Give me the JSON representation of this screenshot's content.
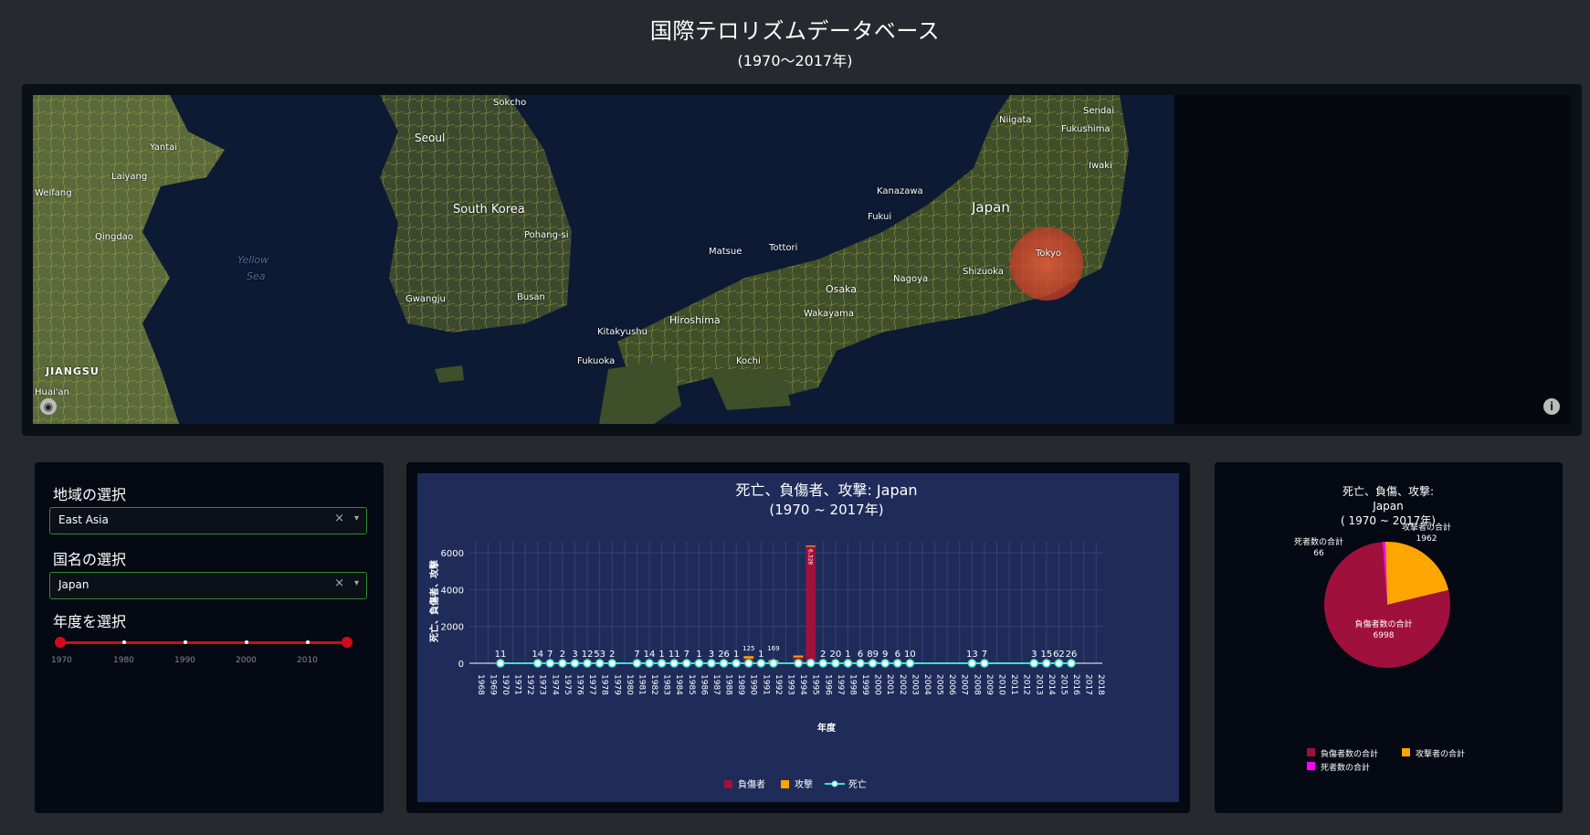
{
  "header": {
    "title": "国際テロリズムデータベース",
    "subtitle": "(1970～2017年)"
  },
  "map": {
    "labels": [
      {
        "name": "Sokcho"
      },
      {
        "name": "Yantai"
      },
      {
        "name": "Seoul"
      },
      {
        "name": "Laiyang"
      },
      {
        "name": "Weifang"
      },
      {
        "name": "Qingdao"
      },
      {
        "name": "South Korea"
      },
      {
        "name": "Yellow"
      },
      {
        "name": "Sea"
      },
      {
        "name": "Pohang-si"
      },
      {
        "name": "Gwangju"
      },
      {
        "name": "Busan"
      },
      {
        "name": "JIANGSU"
      },
      {
        "name": "Huai'an"
      },
      {
        "name": "Niigata"
      },
      {
        "name": "Sendai"
      },
      {
        "name": "Fukushima"
      },
      {
        "name": "Iwaki"
      },
      {
        "name": "Kanazawa"
      },
      {
        "name": "Japan"
      },
      {
        "name": "Fukui"
      },
      {
        "name": "Matsue"
      },
      {
        "name": "Tottori"
      },
      {
        "name": "Tokyo"
      },
      {
        "name": "Shizuoka"
      },
      {
        "name": "Nagoya"
      },
      {
        "name": "Osaka"
      },
      {
        "name": "Hiroshima"
      },
      {
        "name": "Wakayama"
      },
      {
        "name": "Kitakyushu"
      },
      {
        "name": "Fukuoka"
      },
      {
        "name": "Kochi"
      }
    ],
    "info_icon": "info-icon",
    "logo_icon": "mapbox-logo-icon"
  },
  "filters": {
    "region_label": "地域の選択",
    "region_value": "East Asia",
    "country_label": "国名の選択",
    "country_value": "Japan",
    "year_label": "年度を選択",
    "year_marks": [
      "1970",
      "1980",
      "1990",
      "2000",
      "2010"
    ],
    "year_range": [
      1970,
      2017
    ],
    "clear_glyph": "×",
    "arrow_glyph": "▾"
  },
  "chart_data": [
    {
      "type": "bar",
      "title": "死亡、負傷者、攻撃: Japan",
      "subtitle": "(1970 ~ 2017年)",
      "xlabel": "年度",
      "ylabel": "死亡、負傷者、攻撃",
      "ylim": [
        0,
        6600
      ],
      "yticks": [
        0,
        2000,
        4000,
        6000
      ],
      "ytick_labels": [
        "0",
        "2000",
        "4000",
        "6000"
      ],
      "xrange": [
        1967.5,
        2018.5
      ],
      "xticks": [
        1968,
        1969,
        1970,
        1971,
        1972,
        1973,
        1974,
        1975,
        1976,
        1977,
        1978,
        1979,
        1980,
        1981,
        1982,
        1983,
        1984,
        1985,
        1986,
        1987,
        1988,
        1989,
        1990,
        1991,
        1992,
        1993,
        1994,
        1995,
        1996,
        1997,
        1998,
        1999,
        2000,
        2001,
        2002,
        2003,
        2004,
        2005,
        2006,
        2007,
        2008,
        2009,
        2010,
        2011,
        2012,
        2013,
        2014,
        2015,
        2016,
        2017,
        2018
      ],
      "years": [
        1970,
        1973,
        1974,
        1975,
        1976,
        1977,
        1978,
        1979,
        1981,
        1982,
        1983,
        1984,
        1985,
        1986,
        1987,
        1988,
        1989,
        1990,
        1991,
        1992,
        1994,
        1995,
        1996,
        1997,
        1998,
        1999,
        2000,
        2001,
        2002,
        2003,
        2008,
        2009,
        2013,
        2014,
        2015,
        2016
      ],
      "attack_labels": [
        "11",
        "14",
        "7",
        "2",
        "3",
        "12",
        "53",
        "2",
        "7",
        "14",
        "1",
        "11",
        "7",
        "1",
        "3",
        "26",
        "1",
        "125",
        "1",
        "169",
        "",
        "",
        "2",
        "20",
        "1",
        "6",
        "89",
        "9",
        "6",
        "10",
        "13",
        "7",
        "3",
        "15",
        "62",
        "26"
      ],
      "series": [
        {
          "name": "負傷者",
          "color": "#a0103c",
          "values": [
            8,
            0,
            0,
            0,
            0,
            0,
            0,
            0,
            0,
            0,
            0,
            0,
            0,
            0,
            0,
            0,
            0,
            260,
            0,
            0,
            320,
            6328,
            0,
            0,
            0,
            0,
            0,
            0,
            0,
            0,
            0,
            0,
            0,
            0,
            0,
            0
          ]
        },
        {
          "name": "攻撃",
          "color": "#ffa500",
          "values": [
            11,
            14,
            7,
            2,
            3,
            12,
            53,
            2,
            7,
            14,
            1,
            11,
            7,
            1,
            3,
            26,
            1,
            125,
            1,
            169,
            100,
            60,
            2,
            20,
            1,
            6,
            89,
            9,
            6,
            10,
            13,
            7,
            3,
            15,
            62,
            26
          ]
        },
        {
          "name": "死亡",
          "color": "#40e0d0",
          "values": [
            0,
            0,
            0,
            0,
            0,
            0,
            0,
            0,
            0,
            0,
            0,
            0,
            0,
            0,
            0,
            0,
            0,
            0,
            0,
            0,
            0,
            13,
            0,
            0,
            0,
            0,
            0,
            0,
            0,
            0,
            0,
            0,
            0,
            0,
            0,
            0
          ]
        }
      ],
      "bar_value_labels": [
        {
          "year": 1995,
          "text": "6,328"
        }
      ],
      "legend": [
        "負傷者",
        "攻撃",
        "死亡"
      ]
    },
    {
      "type": "pie",
      "title": "死亡、負傷、攻撃:",
      "title_line2": "Japan",
      "title_line3": "( 1970 ~ 2017年)",
      "slices": [
        {
          "name": "負傷者数の合計",
          "value": 6998,
          "value_text": "6998",
          "color": "#a0103c"
        },
        {
          "name": "攻撃者の合計",
          "value": 1962,
          "value_text": "1962",
          "color": "#ffa500"
        },
        {
          "name": "死者数の合計",
          "value": 66,
          "value_text": "66",
          "color": "#ff00ff"
        }
      ],
      "legend": [
        "負傷者数の合計",
        "攻撃者の合計",
        "死者数の合計"
      ]
    }
  ]
}
